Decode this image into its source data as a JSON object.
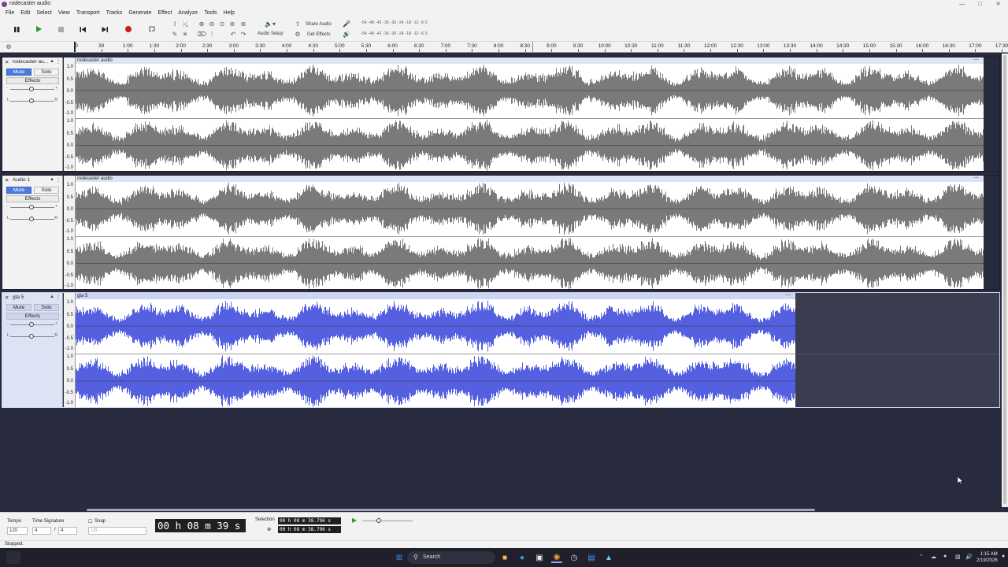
{
  "window": {
    "title": "rodecaster audio"
  },
  "menu": [
    "File",
    "Edit",
    "Select",
    "View",
    "Transport",
    "Tracks",
    "Generate",
    "Effect",
    "Analyze",
    "Tools",
    "Help"
  ],
  "toolbar": {
    "audio_setup": "Audio Setup",
    "share_audio": "Share Audio",
    "get_effects": "Get Effects",
    "record_meter_scale": "-54 -48 -42 -36 -30 -24 -18 -12 -6 0",
    "play_meter_scale": "-54 -48 -42 -36 -30 -24 -18 -12 -6 0"
  },
  "timeline": {
    "ticks": [
      "0",
      "30",
      "1:00",
      "1:30",
      "2:00",
      "2:30",
      "3:00",
      "3:30",
      "4:00",
      "4:30",
      "5:00",
      "5:30",
      "6:00",
      "6:30",
      "7:00",
      "7:30",
      "8:00",
      "8:30",
      "9:00",
      "9:30",
      "10:00",
      "10:30",
      "11:00",
      "11:30",
      "12:00",
      "12:30",
      "13:00",
      "13:30",
      "14:00",
      "14:30",
      "15:00",
      "15:30",
      "16:00",
      "16:30",
      "17:00",
      "17:30"
    ]
  },
  "tracks": [
    {
      "name": "rodecaster au...",
      "clip_name": "rodecaster audio",
      "mute": "Mute",
      "solo": "Solo",
      "effects": "Effects",
      "muted": true,
      "scale": [
        "1.0",
        "0.5",
        "0.0",
        "-0.5",
        "-1.0"
      ],
      "color": "#7a7a7a",
      "selected": false
    },
    {
      "name": "Audio 1",
      "clip_name": "rodecaster audio",
      "mute": "Mute",
      "solo": "Solo",
      "effects": "Effects",
      "muted": true,
      "scale": [
        "1.0",
        "0.5",
        "0.0",
        "-0.5",
        "-1.0"
      ],
      "color": "#7a7a7a",
      "selected": false
    },
    {
      "name": "gta 5",
      "clip_name": "gta 5",
      "mute": "Mute",
      "solo": "Solo",
      "effects": "Effects",
      "muted": false,
      "scale": [
        "1.0",
        "0.5",
        "0.0",
        "-0.5",
        "-1.0"
      ],
      "color": "#5460e0",
      "selected": true
    }
  ],
  "bottom": {
    "tempo_label": "Tempo",
    "tempo_value": "120",
    "time_sig_label": "Time Signature",
    "time_sig_num": "4",
    "time_sig_slash": "/",
    "time_sig_den": "4",
    "snap_label": "Snap",
    "snap_value": "1/8",
    "time": "00 h 08 m 39 s",
    "selection_label": "Selection",
    "selection_start": "00 h 08 m 38.796 s",
    "selection_end": "00 h 08 m 38.796 s"
  },
  "status": "Stopped.",
  "taskbar": {
    "search": "Search",
    "time": "1:15 AM",
    "date": "2/19/2026"
  }
}
